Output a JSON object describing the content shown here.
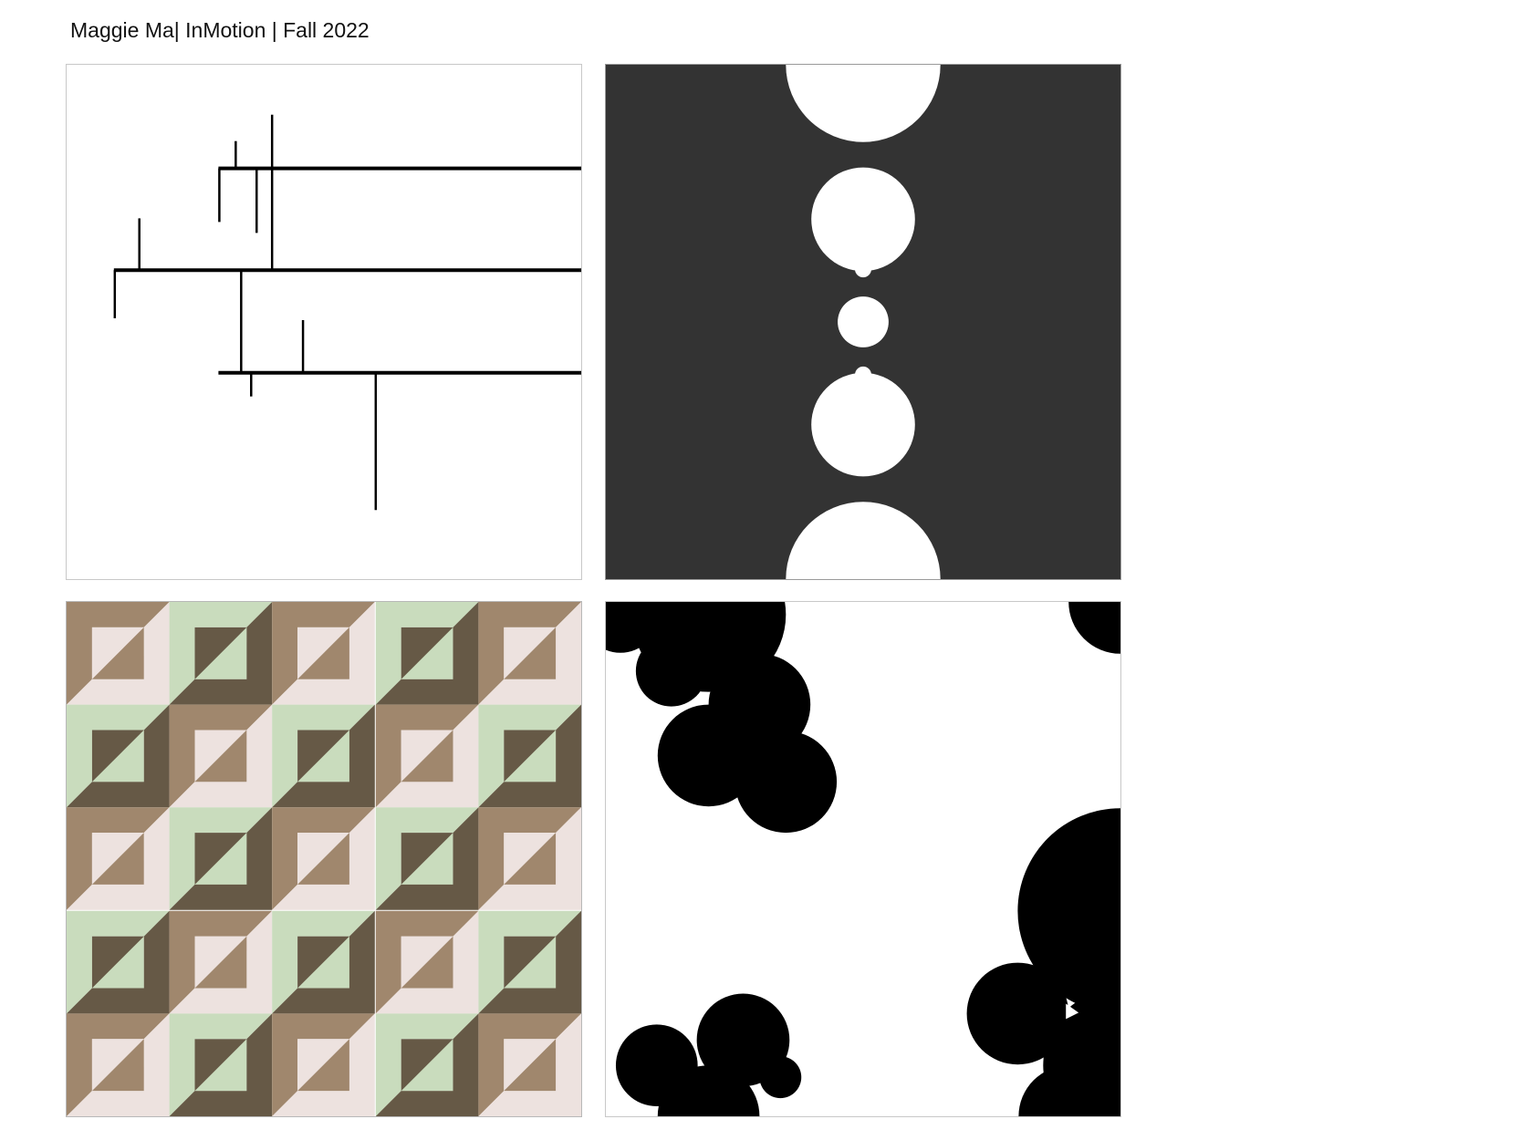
{
  "header": {
    "title": "Maggie Ma| InMotion | Fall 2022"
  },
  "colors": {
    "background": "#ffffff",
    "ink": "#000000",
    "panel_dark": "#333333",
    "tile_tan": "#a0876d",
    "tile_dark_brown": "#665946",
    "tile_sage": "#c9dcbd",
    "tile_blush": "#ede2df"
  },
  "artworks": [
    {
      "name": "thin line composition",
      "palette": [
        "#ffffff",
        "#000000"
      ]
    },
    {
      "name": "white circles on charcoal",
      "palette": [
        "#333333",
        "#ffffff"
      ]
    },
    {
      "name": "geometric tile pattern",
      "palette": [
        "#a0876d",
        "#665946",
        "#c9dcbd",
        "#ede2df"
      ]
    },
    {
      "name": "black circle clusters",
      "palette": [
        "#ffffff",
        "#000000"
      ]
    }
  ]
}
